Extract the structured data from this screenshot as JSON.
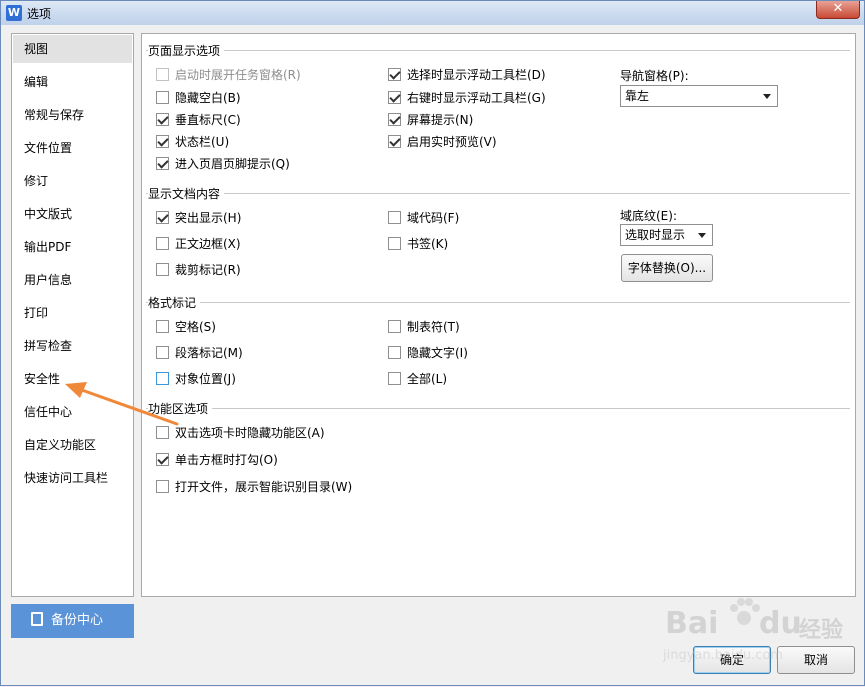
{
  "window": {
    "title": "选项",
    "app_icon": "W",
    "close_glyph": "✕"
  },
  "sidebar": {
    "items": [
      {
        "label": "视图",
        "selected": true
      },
      {
        "label": "编辑"
      },
      {
        "label": "常规与保存"
      },
      {
        "label": "文件位置"
      },
      {
        "label": "修订"
      },
      {
        "label": "中文版式"
      },
      {
        "label": "输出PDF"
      },
      {
        "label": "用户信息"
      },
      {
        "label": "打印"
      },
      {
        "label": "拼写检查"
      },
      {
        "label": "安全性"
      },
      {
        "label": "信任中心"
      },
      {
        "label": "自定义功能区"
      },
      {
        "label": "快速访问工具栏"
      }
    ],
    "backup_label": "备份中心"
  },
  "page_display": {
    "title": "页面显示选项",
    "options": [
      {
        "label": "启动时展开任务窗格(R)",
        "checked": false,
        "disabled": true
      },
      {
        "label": "隐藏空白(B)",
        "checked": false
      },
      {
        "label": "垂直标尺(C)",
        "checked": true
      },
      {
        "label": "状态栏(U)",
        "checked": true
      },
      {
        "label": "进入页眉页脚提示(Q)",
        "checked": true
      },
      {
        "label": "选择时显示浮动工具栏(D)",
        "checked": true
      },
      {
        "label": "右键时显示浮动工具栏(G)",
        "checked": true
      },
      {
        "label": "屏幕提示(N)",
        "checked": true
      },
      {
        "label": "启用实时预览(V)",
        "checked": true
      }
    ],
    "nav_pane_label": "导航窗格(P):",
    "nav_pane_value": "靠左"
  },
  "doc_content": {
    "title": "显示文档内容",
    "options": [
      {
        "label": "突出显示(H)",
        "checked": true
      },
      {
        "label": "正文边框(X)",
        "checked": false
      },
      {
        "label": "裁剪标记(R)",
        "checked": false
      },
      {
        "label": "域代码(F)",
        "checked": false
      },
      {
        "label": "书签(K)",
        "checked": false
      }
    ],
    "field_shading_label": "域底纹(E):",
    "field_shading_value": "选取时显示",
    "font_replace_label": "字体替换(O)..."
  },
  "format_marks": {
    "title": "格式标记",
    "options": [
      {
        "label": "空格(S)",
        "checked": false
      },
      {
        "label": "段落标记(M)",
        "checked": false
      },
      {
        "label": "对象位置(J)",
        "checked": false
      },
      {
        "label": "制表符(T)",
        "checked": false
      },
      {
        "label": "隐藏文字(I)",
        "checked": false
      },
      {
        "label": "全部(L)",
        "checked": false
      }
    ]
  },
  "ribbon": {
    "title": "功能区选项",
    "options": [
      {
        "label": "双击选项卡时隐藏功能区(A)",
        "checked": false
      },
      {
        "label": "单击方框时打勾(O)",
        "checked": true
      },
      {
        "label": "打开文件，展示智能识别目录(W)",
        "checked": false
      }
    ]
  },
  "footer": {
    "ok_label": "确定",
    "cancel_label": "取消"
  },
  "watermark": {
    "brand": "Bai",
    "brand2": "du",
    "cn": "经验",
    "url": "jingyan.baidu.com"
  },
  "colors": {
    "accent": "#5b93d8",
    "arrow": "#f0883a"
  }
}
